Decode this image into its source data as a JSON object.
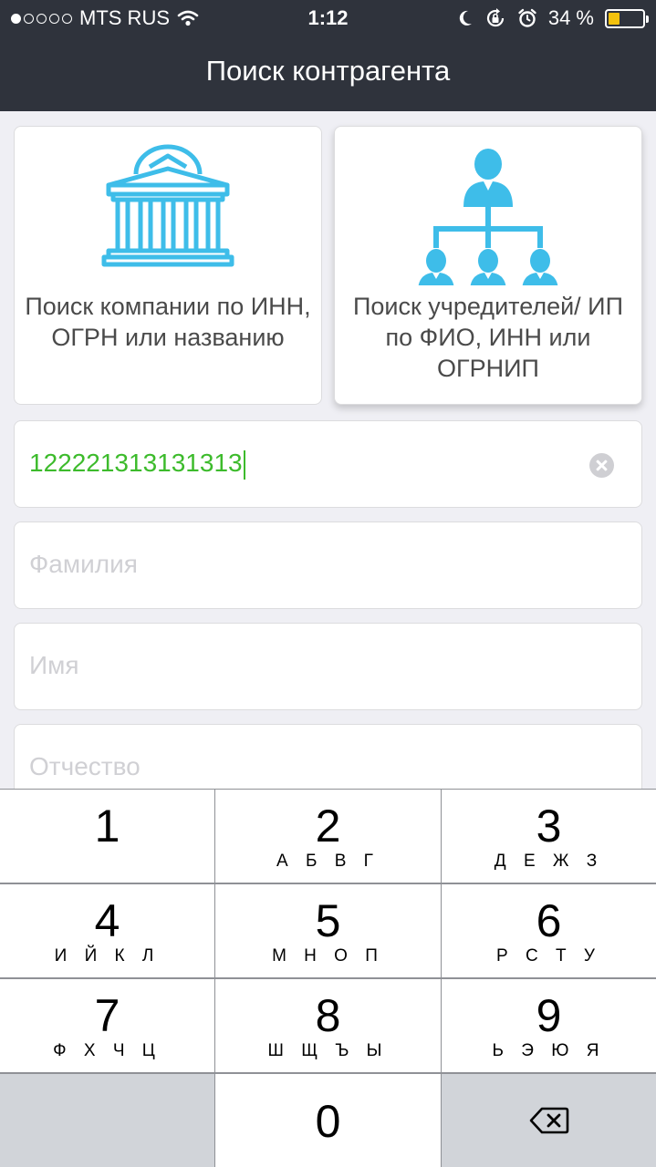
{
  "status_bar": {
    "carrier": "MTS RUS",
    "time": "1:12",
    "battery_percent": "34 %",
    "battery_level": 0.34,
    "signal_bars_filled": 1,
    "signal_bars_total": 5,
    "icons": [
      "wifi-icon",
      "moon-icon",
      "rotation-lock-icon",
      "alarm-icon",
      "battery-icon"
    ]
  },
  "nav": {
    "title": "Поиск контрагента"
  },
  "cards": [
    {
      "icon": "building-icon",
      "label": "Поиск компании по ИНН, ОГРН или названию"
    },
    {
      "icon": "org-chart-people-icon",
      "label": "Поиск учредителей/ ИП по ФИО, ИНН или ОГРНИП"
    }
  ],
  "fields": {
    "inn": {
      "value": "122221313131313"
    },
    "surname": {
      "placeholder": "Фамилия"
    },
    "name": {
      "placeholder": "Имя"
    },
    "patronymic": {
      "placeholder": "Отчество"
    }
  },
  "keypad": {
    "keys": [
      {
        "num": "1",
        "letters": ""
      },
      {
        "num": "2",
        "letters": "А Б В Г"
      },
      {
        "num": "3",
        "letters": "Д Е Ж З"
      },
      {
        "num": "4",
        "letters": "И Й К Л"
      },
      {
        "num": "5",
        "letters": "М Н О П"
      },
      {
        "num": "6",
        "letters": "Р С Т У"
      },
      {
        "num": "7",
        "letters": "Ф Х Ч Ц"
      },
      {
        "num": "8",
        "letters": "Ш Щ Ъ Ы"
      },
      {
        "num": "9",
        "letters": "Ь Э Ю Я"
      },
      {
        "num": "0",
        "letters": ""
      }
    ],
    "delete_icon": "backspace-icon"
  },
  "colors": {
    "nav_bg": "#2f333c",
    "accent_icon": "#3ebde9",
    "input_text": "#3dbb2c",
    "battery_fill": "#f4c20d"
  }
}
